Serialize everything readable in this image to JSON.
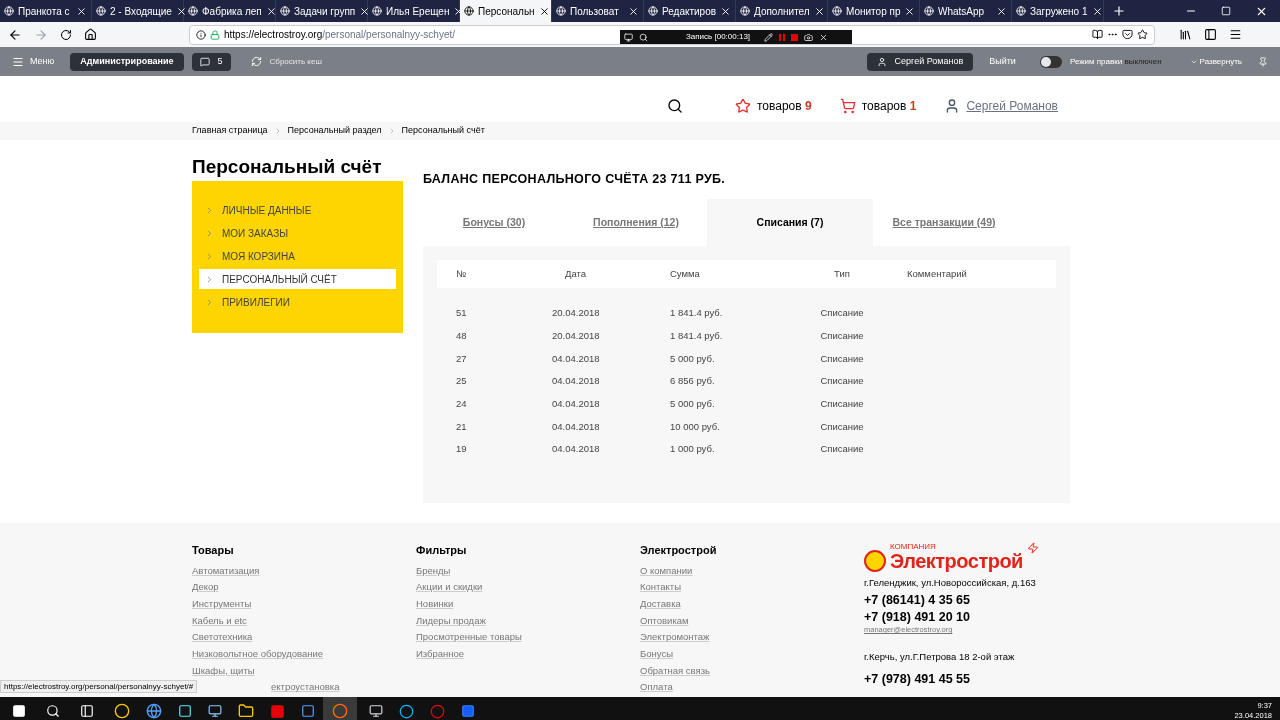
{
  "browser": {
    "tabs": [
      {
        "title": "Пранкота с",
        "selected": false
      },
      {
        "title": "2 - Входящие",
        "selected": false
      },
      {
        "title": "Фабрика леп",
        "selected": false
      },
      {
        "title": "Задачи групп",
        "selected": false
      },
      {
        "title": "Илья Ерещен",
        "selected": false
      },
      {
        "title": "Персональн",
        "selected": true
      },
      {
        "title": "Пользоват",
        "selected": false
      },
      {
        "title": "Редактиров",
        "selected": false
      },
      {
        "title": "Дополнител",
        "selected": false
      },
      {
        "title": "Монитор пр",
        "selected": false
      },
      {
        "title": "WhatsApp",
        "selected": false
      },
      {
        "title": "Загружено 1",
        "selected": false
      }
    ],
    "url_host": "https://electrostroy.org",
    "url_path": "/personal/personalnyy-schyet/"
  },
  "recorder": {
    "status": "Запись [00:00:13]"
  },
  "admin_bar": {
    "menu": "Меню",
    "admin": "Администрирование",
    "count": "5",
    "clear_cache": "Сбросить кеш",
    "user": "Сергей Романов",
    "logout": "Выйти",
    "edit_mode_label": "Режим правки",
    "edit_mode_state": "выключен",
    "edit_mode_on": false,
    "expand": "Развернуть"
  },
  "header": {
    "favorites_label": "товаров",
    "favorites_count": "9",
    "cart_label": "товаров",
    "cart_count": "1",
    "user": "Сергей Романов"
  },
  "breadcrumbs": [
    "Главная страница",
    "Персональный раздел",
    "Персональный счёт"
  ],
  "page_title": "Персональный счёт",
  "sidebar": {
    "items": [
      {
        "label": "ЛИЧНЫЕ ДАННЫЕ",
        "selected": false
      },
      {
        "label": "МОИ ЗАКАЗЫ",
        "selected": false
      },
      {
        "label": "МОЯ КОРЗИНА",
        "selected": false
      },
      {
        "label": "ПЕРСОНАЛЬНЫЙ СЧЁТ",
        "selected": true
      },
      {
        "label": "ПРИВИЛЕГИИ",
        "selected": false
      }
    ]
  },
  "balance": "БАЛАНС ПЕРСОНАЛЬНОГО СЧЁТА 23 711 РУБ.",
  "tabs": [
    {
      "label": "Бонусы (30)",
      "selected": false
    },
    {
      "label": "Пополнения (12)",
      "selected": false
    },
    {
      "label": "Списания (7)",
      "selected": true
    },
    {
      "label": "Все транзакции (49)",
      "selected": false
    }
  ],
  "table": {
    "columns": [
      "№",
      "Дата",
      "Сумма",
      "Тип",
      "Комментарий"
    ],
    "rows": [
      [
        "51",
        "20.04.2018",
        "1 841.4 руб.",
        "Списание"
      ],
      [
        "48",
        "20.04.2018",
        "1 841.4 руб.",
        "Списание"
      ],
      [
        "27",
        "04.04.2018",
        "5 000 руб.",
        "Списание"
      ],
      [
        "25",
        "04.04.2018",
        "6 856 руб.",
        "Списание"
      ],
      [
        "24",
        "04.04.2018",
        "5 000 руб.",
        "Списание"
      ],
      [
        "21",
        "04.04.2018",
        "10 000 руб.",
        "Списание"
      ],
      [
        "19",
        "04.04.2018",
        "1 000 руб.",
        "Списание"
      ]
    ]
  },
  "footer": {
    "columns": [
      {
        "title": "Товары",
        "links": [
          {
            "label": "Автоматизация",
            "kind": "full"
          },
          {
            "label": "Декор",
            "kind": "full"
          },
          {
            "label": "Инструменты",
            "kind": "full"
          },
          {
            "label": "Кабель и etc",
            "kind": "full"
          },
          {
            "label": "Светотехника",
            "kind": "full"
          },
          {
            "label": "Низковольтное оборудование",
            "kind": "full"
          },
          {
            "label": "Шкафы, щиты",
            "kind": "full"
          },
          {
            "label": "ектроустановка",
            "kind": "covered"
          }
        ]
      },
      {
        "title": "Фильтры",
        "links": [
          {
            "label": "Бренды",
            "kind": "full"
          },
          {
            "label": "Акции и скидки",
            "kind": "full"
          },
          {
            "label": "Новинки",
            "kind": "full"
          },
          {
            "label": "Лидеры продаж",
            "kind": "full"
          },
          {
            "label": "Просмотренные товары",
            "kind": "full"
          },
          {
            "label": "Избранное",
            "kind": "full"
          }
        ]
      },
      {
        "title": "Электрострой",
        "links": [
          {
            "label": "О компании",
            "kind": "full"
          },
          {
            "label": "Контакты",
            "kind": "full"
          },
          {
            "label": "Доставка",
            "kind": "full"
          },
          {
            "label": "Оптовикам",
            "kind": "full"
          },
          {
            "label": "Электромонтаж",
            "kind": "full"
          },
          {
            "label": "Бонусы",
            "kind": "full"
          },
          {
            "label": "Обратная связь",
            "kind": "full"
          },
          {
            "label": "Оплата",
            "kind": "full"
          }
        ]
      }
    ],
    "logo_small": "КОМПАНИЯ",
    "logo": "Электрострой",
    "address1": "г.Геленджик, ул.Новороссийская, д.163",
    "phones1": [
      "+7 (86141) 4 35 65",
      "+7 (918) 491 20 10"
    ],
    "email": "manager@electrostroy.org",
    "address2": "г.Керчь, ул.Г.Петрова 18 2-ой этаж",
    "phones2": [
      "+7 (978) 491 45 55"
    ]
  },
  "status_url": "https://electrostroy.org/personal/personalnyy-schyet/#",
  "taskbar": {
    "time": "9:37",
    "date": "23.04.2018"
  }
}
